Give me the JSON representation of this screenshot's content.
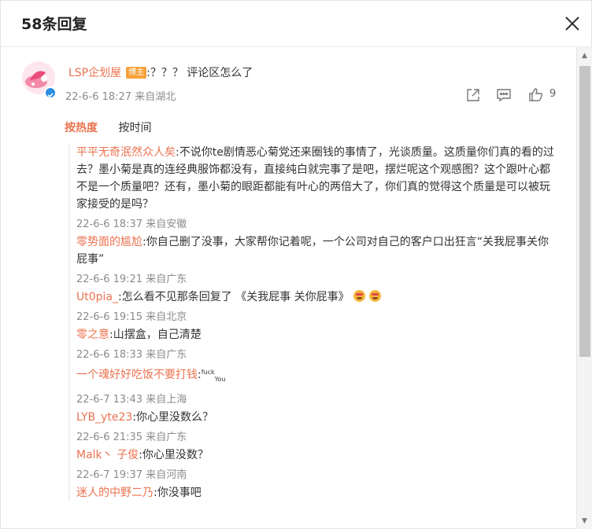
{
  "header": {
    "title": "58条回复"
  },
  "main_comment": {
    "username": "LSP企划屋",
    "badge": "博主",
    "text": ":？？？ 评论区怎么了",
    "meta": "22-6-6 18:27 来自湖北",
    "like_count": "9",
    "icons": [
      "share-icon",
      "comment-icon",
      "like-icon"
    ]
  },
  "sort": {
    "tabs": [
      "按热度",
      "按时间"
    ],
    "active": 0
  },
  "replies": [
    {
      "user": "平平无奇泯然众人矣",
      "text": ":不说你te剧情恶心菊党还来圈钱的事情了，光谈质量。这质量你们真的看的过去？墨小菊是真的连经典服饰都没有，直接纯白就完事了是吧，摆烂呢这个观感图？这个跟叶心都不是一个质量吧？还有，墨小菊的眼距都能有叶心的两倍大了，你们真的觉得这个质量是可以被玩家接受的是吗？",
      "meta": "22-6-6 18:37 来自安徽"
    },
    {
      "user": "零势面的尴尬",
      "text": ":你自己删了没事，大家帮你记着呢，一个公司对自己的客户口出狂言“关我屁事关你屁事”",
      "meta": "22-6-6 19:21 来自广东"
    },
    {
      "user": "Ut0pia_",
      "text": ":怎么看不见那条回复了 《关我屁事 关你屁事》",
      "meta": "22-6-6 19:15 来自北京"
    },
    {
      "user": "零之意",
      "text": ":山摆盒，自己清楚",
      "meta": "22-6-6 18:33 来自广东"
    },
    {
      "user": "一个魂好好吃饭不要打钱",
      "text_sup": "fuck",
      "text_sub": "You",
      "meta": "22-6-7 13:43 来自上海"
    },
    {
      "user": "LYB_yte23",
      "text": ":你心里没数么？",
      "meta": "22-6-6 21:35 来自广东"
    },
    {
      "user": "Malk丶 子俊",
      "text": ":你心里没数？",
      "meta": "22-6-7 19:37 来自河南"
    },
    {
      "user": "迷人的中野二乃",
      "text": ":你没事吧",
      "meta": ""
    }
  ],
  "colors": {
    "accent": "#eb7350",
    "badge": "#f7a13b",
    "meta": "#8b8b8b",
    "verified": "#2b8de0"
  }
}
